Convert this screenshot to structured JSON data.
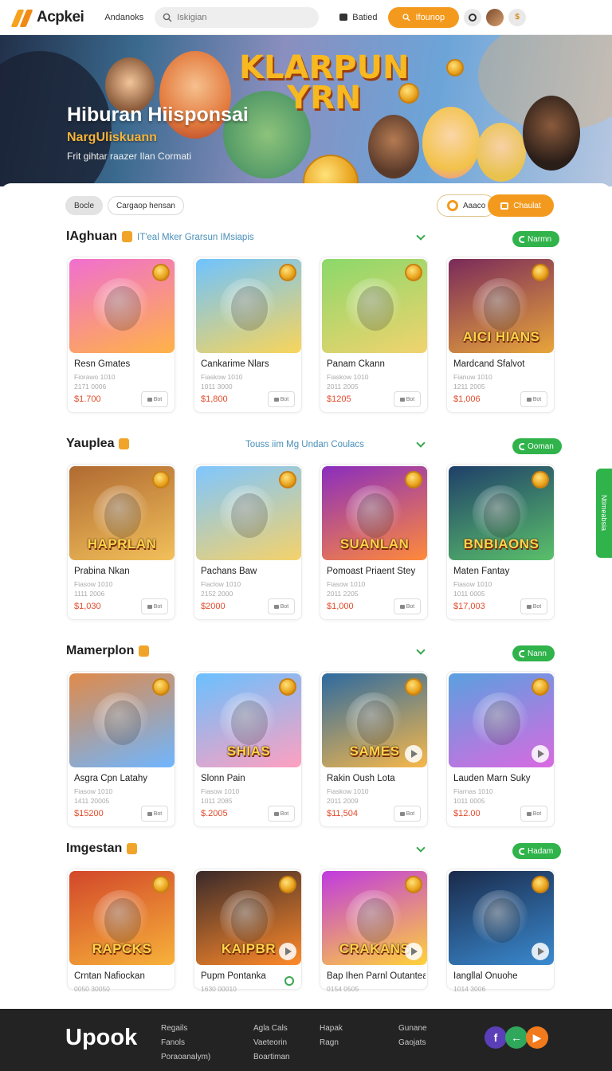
{
  "header": {
    "logo_text": "Acpkei",
    "nav_link": "Andanoks",
    "search_placeholder": "Iskigian",
    "saved_label": "Batied",
    "cta_label": "Ifounop",
    "accent_color": "#f39a1e"
  },
  "hero": {
    "brand_line1": "KLARPUN",
    "brand_line2": "YRN",
    "title": "Hiburan Hiisponsai",
    "subtitle": "NargUliskuann",
    "description": "Frit gihtar raazer Ilan Cormati"
  },
  "filters": {
    "chips": [
      "Bocle",
      "Cargaop hensan"
    ],
    "right_chip": "Aaaco",
    "right_button": "Chaulat"
  },
  "sections": [
    {
      "title": "IAghuan",
      "description": "IT'eal Mker Grarsun IMsiapis",
      "pill": "Narmn",
      "cards": [
        {
          "name": "Resn Gmates",
          "meta1": "Fiorawo 1010",
          "meta2": "2171 0006",
          "price": "$1.700"
        },
        {
          "name": "Cankarime Nlars",
          "meta1": "Fiaskow 1010",
          "meta2": "1011 3000",
          "price": "$1,800"
        },
        {
          "name": "Panam Ckann",
          "meta1": "Fiaskow 1010",
          "meta2": "2011 2005",
          "price": "$1205"
        },
        {
          "name": "Mardcand Sfalvot",
          "meta1": "Fianuw 1010",
          "meta2": "1211 2005",
          "price": "$1,006"
        }
      ]
    },
    {
      "title": "Yauplea",
      "description": "Touss iim Mg Undan Coulacs",
      "pill": "Ooman",
      "cards": [
        {
          "name": "Prabina Nkan",
          "meta1": "Fiasow 1010",
          "meta2": "1111 2006",
          "price": "$1,030"
        },
        {
          "name": "Pachans Baw",
          "meta1": "Fiaclow 1010",
          "meta2": "2152 2000",
          "price": "$2000"
        },
        {
          "name": "Pomoast Priaent Stey",
          "meta1": "Fiasow 1010",
          "meta2": "2011 2205",
          "price": "$1,000"
        },
        {
          "name": "Maten Fantay",
          "meta1": "Fiasow 1010",
          "meta2": "1011 0005",
          "price": "$17,003"
        }
      ]
    },
    {
      "title": "Mamerplon",
      "description": "",
      "pill": "Nann",
      "cards": [
        {
          "name": "Asgra Cpn Latahy",
          "meta1": "Fiasow 1010",
          "meta2": "1411 20005",
          "price": "$15200"
        },
        {
          "name": "Slonn Pain",
          "meta1": "Fiasow 1010",
          "meta2": "1011 2085",
          "price": "$.2005"
        },
        {
          "name": "Rakin Oush Lota",
          "meta1": "Fiaskow 1010",
          "meta2": "2011 2009",
          "price": "$11,504"
        },
        {
          "name": "Lauden Marn Suky",
          "meta1": "Fiarnas 1010",
          "meta2": "1011 0005",
          "price": "$12.00"
        }
      ]
    },
    {
      "title": "Imgestan",
      "description": "",
      "pill": "Hadam",
      "cards": [
        {
          "name": "Crntan Nafiockan",
          "meta1": "0050 30050",
          "meta2": "",
          "price": ""
        },
        {
          "name": "Pupm Pontanka",
          "meta1": "1630 00010",
          "meta2": "",
          "price": ""
        },
        {
          "name": "Bap Ihen Parnl Outantea",
          "meta1": "0154 0505",
          "meta2": "",
          "price": ""
        },
        {
          "name": "Iangllal Onuohe",
          "meta1": "1014 3006",
          "meta2": "",
          "price": ""
        }
      ]
    }
  ],
  "thumb_titles": {
    "s0c3": "AICI HIANS",
    "s1c0": "HAPRLAN",
    "s1c2": "SUANLAN",
    "s1c3": "BNBIAONS",
    "s2c1": "SHIAS",
    "s2c2": "SAMES",
    "s3c1": "KAIPBR",
    "s3c2": "CRAKANS",
    "s3c0": "RAPCKS"
  },
  "card_button_label": "Bot",
  "side_tab_label": "Ntimeabsia",
  "footer": {
    "brand": "Upook",
    "col1": [
      "Regails",
      "Fanols",
      "Poraoanalym)"
    ],
    "col2": [
      "Agla Cals",
      "Vaeteorin",
      "Boartiman"
    ],
    "col3": [
      "Hapak",
      "Ragn"
    ],
    "col4": [
      "Gunane",
      "Gaojats"
    ],
    "social_icons": [
      "facebook-icon",
      "arrow-icon",
      "play-icon"
    ]
  }
}
